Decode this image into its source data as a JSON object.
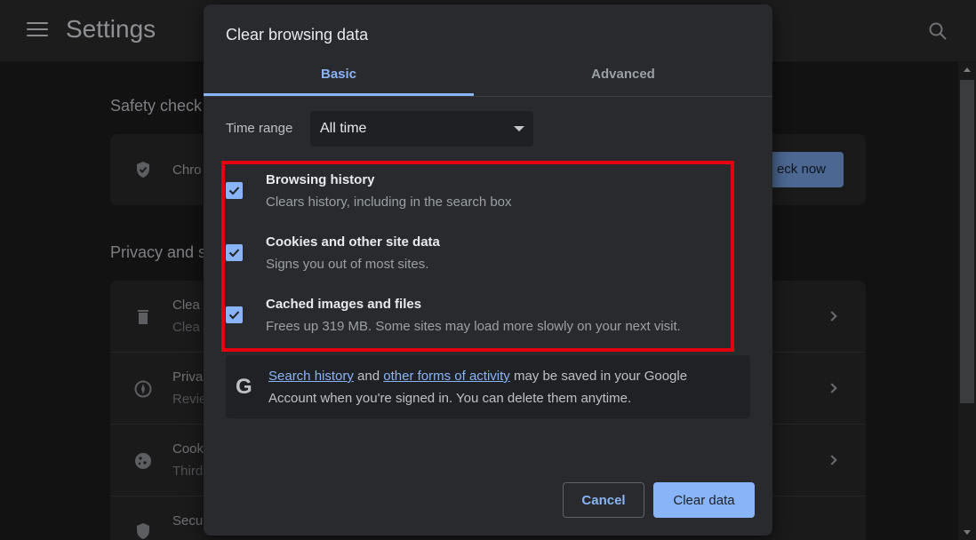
{
  "app": {
    "title": "Settings",
    "menu_icon": "hamburger-menu-icon",
    "search_icon": "search-icon"
  },
  "background": {
    "safety_check": {
      "title": "Safety check",
      "row_text": "Chro",
      "button_label": "eck now"
    },
    "privacy": {
      "title": "Privacy and s",
      "rows": [
        {
          "icon": "trash-icon",
          "title": "Clea",
          "subtitle": "Clea"
        },
        {
          "icon": "compass-icon",
          "title": "Priva",
          "subtitle": "Revie"
        },
        {
          "icon": "cookie-icon",
          "title": "Cook",
          "subtitle": "Third"
        },
        {
          "icon": "shield-icon",
          "title": "Secu",
          "subtitle": ""
        }
      ]
    }
  },
  "dialog": {
    "title": "Clear browsing data",
    "tabs": [
      {
        "label": "Basic",
        "selected": true
      },
      {
        "label": "Advanced",
        "selected": false
      }
    ],
    "time_range": {
      "label": "Time range",
      "value": "All time"
    },
    "options": [
      {
        "title": "Browsing history",
        "description": "Clears history, including in the search box",
        "checked": true
      },
      {
        "title": "Cookies and other site data",
        "description": "Signs you out of most sites.",
        "checked": true
      },
      {
        "title": "Cached images and files",
        "description": "Frees up 319 MB. Some sites may load more slowly on your next visit.",
        "checked": true
      }
    ],
    "google_note": {
      "icon": "google-g-icon",
      "link1": "Search history",
      "text1": " and ",
      "link2": "other forms of activity",
      "text2": " may be saved in your Google",
      "line2": "Account when you're signed in. You can delete them anytime."
    },
    "buttons": {
      "cancel": "Cancel",
      "clear": "Clear data"
    }
  },
  "colors": {
    "accent": "#8ab4f8",
    "dialog_bg": "#292a2d",
    "highlight": "#e4000f"
  }
}
